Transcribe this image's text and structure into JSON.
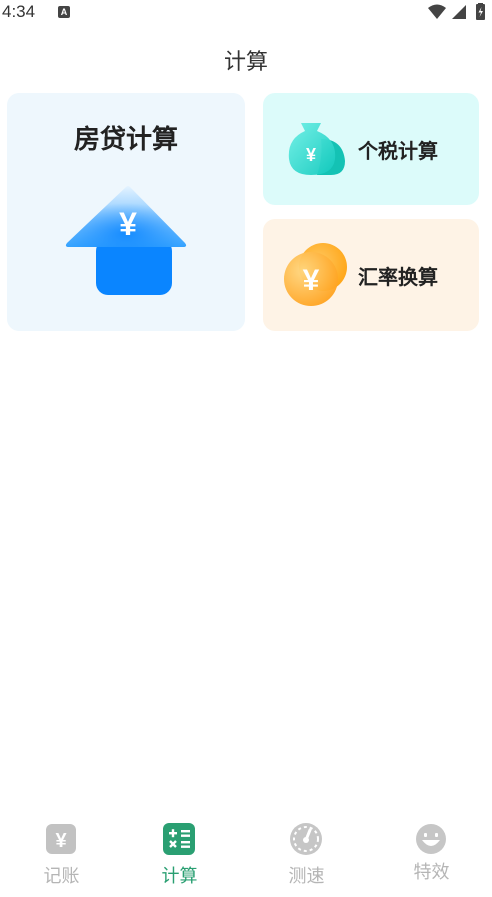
{
  "status_bar": {
    "time": "4:34",
    "notification_letter": "A"
  },
  "page_title": "计算",
  "cards": {
    "mortgage": {
      "label": "房贷计算",
      "icon": "house-yen-icon"
    },
    "tax": {
      "label": "个税计算",
      "icon": "money-bag-yen-icon"
    },
    "exchange": {
      "label": "汇率换算",
      "icon": "coins-yen-icon"
    }
  },
  "tabs": [
    {
      "label": "记账",
      "icon": "ledger-yen-icon",
      "active": false
    },
    {
      "label": "计算",
      "icon": "calculator-icon",
      "active": true
    },
    {
      "label": "测速",
      "icon": "speedometer-icon",
      "active": false
    },
    {
      "label": "特效",
      "icon": "smiley-icon",
      "active": false
    }
  ],
  "colors": {
    "accent": "#2a9f72",
    "inactive_tab": "#b5b5b5",
    "mortgage_bg": "#eef7fd",
    "tax_bg": "#dcfbfa",
    "exchange_bg": "#fef3e6"
  }
}
